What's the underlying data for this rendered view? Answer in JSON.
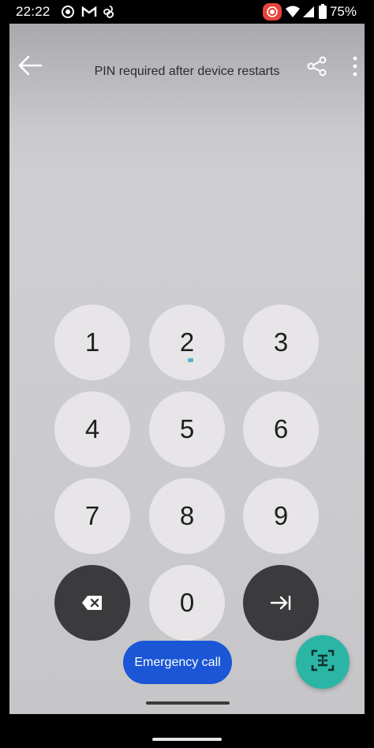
{
  "status_bar": {
    "time": "22:22",
    "battery": "75%",
    "icons": [
      "settings-icon",
      "gmail-icon",
      "pinwheel-icon",
      "record-icon",
      "wifi-icon",
      "signal-icon",
      "battery-icon"
    ]
  },
  "topbar": {
    "title": "PIN required after device restarts",
    "icons": [
      "back-arrow-icon",
      "share-icon",
      "more-vert-icon"
    ]
  },
  "keypad": {
    "keys": [
      "1",
      "2",
      "3",
      "4",
      "5",
      "6",
      "7",
      "8",
      "9",
      "0"
    ],
    "backspace_icon": "backspace-icon",
    "enter_icon": "enter-tab-icon"
  },
  "emergency_button": {
    "label": "Emergency call"
  },
  "fab": {
    "icon": "text-scan-icon"
  },
  "colors": {
    "emergency_blue": "#1a56d6",
    "fab_teal": "#2bb5a5",
    "key_light": "#e7e5e8",
    "key_dark": "#3b3b3d"
  }
}
